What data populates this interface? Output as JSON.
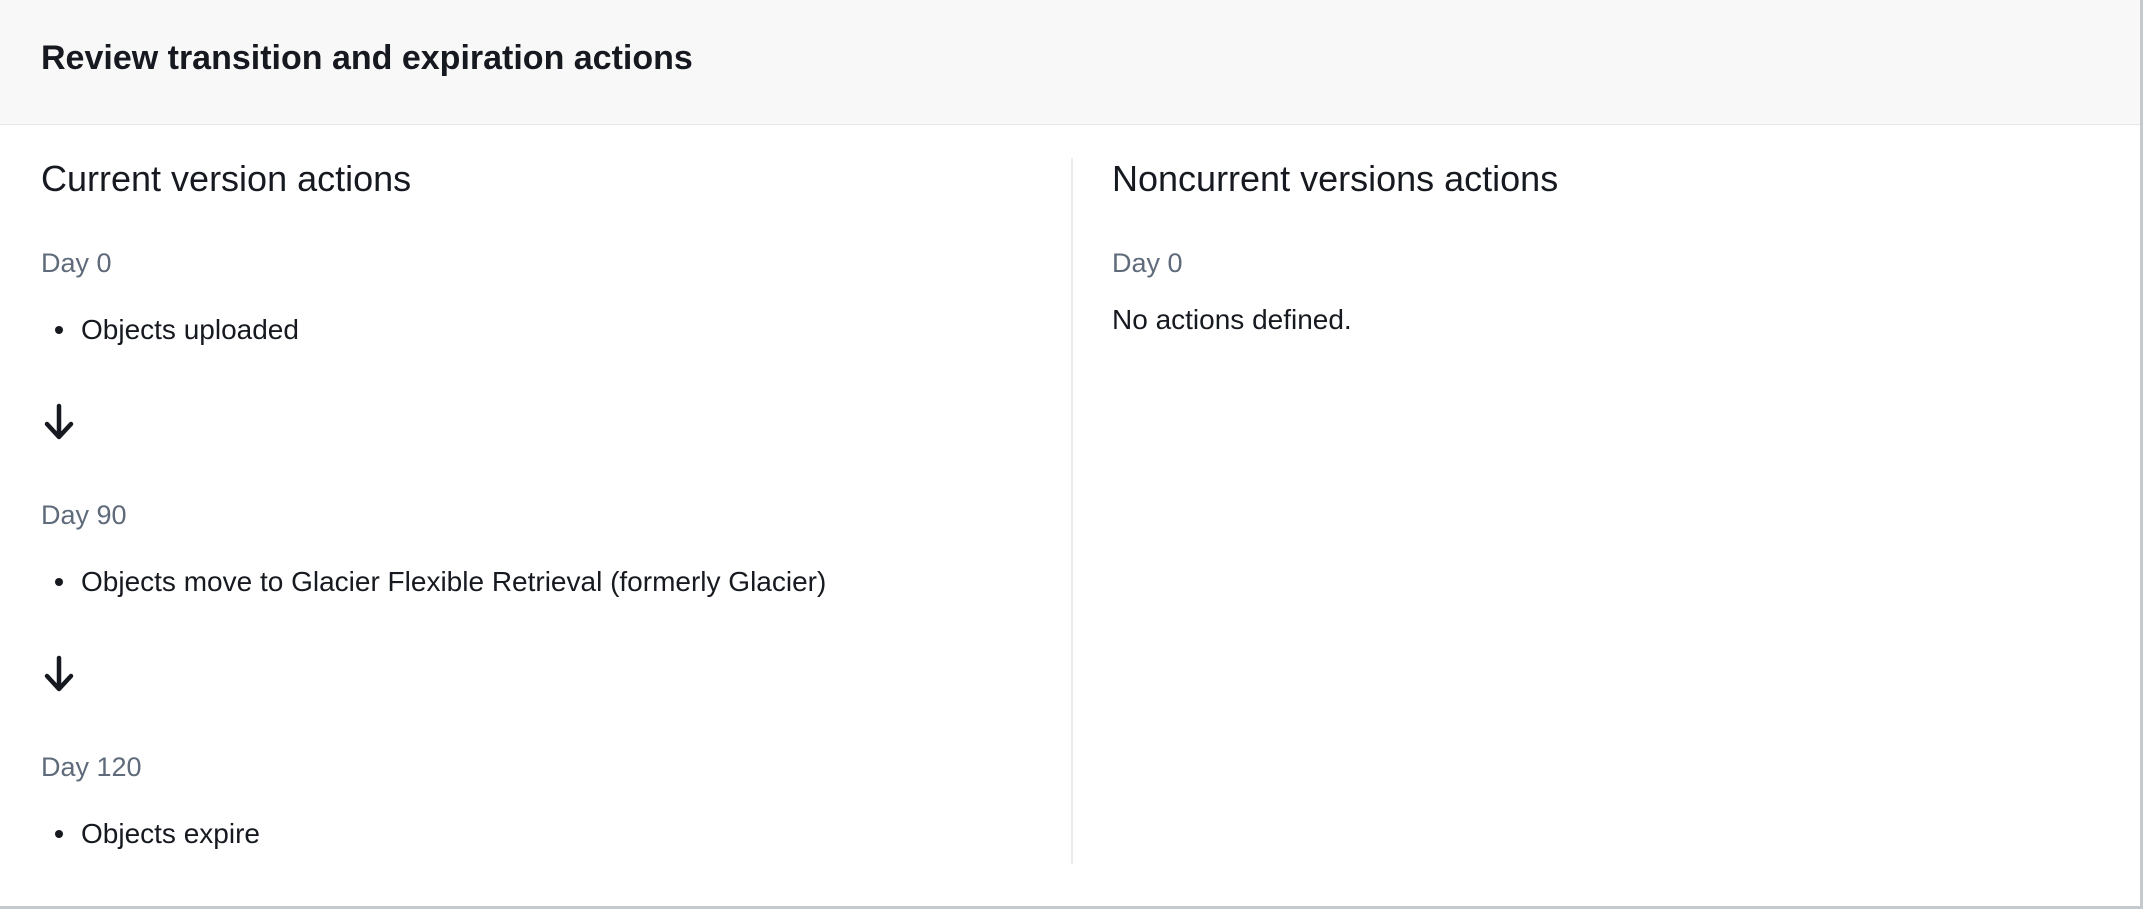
{
  "panel": {
    "title": "Review transition and expiration actions"
  },
  "current": {
    "title": "Current version actions",
    "steps": [
      {
        "day": "Day 0",
        "action": "Objects uploaded"
      },
      {
        "day": "Day 90",
        "action": "Objects move to Glacier Flexible Retrieval (formerly Glacier)"
      },
      {
        "day": "Day 120",
        "action": "Objects expire"
      }
    ],
    "arrow_icon": "arrow-down-icon"
  },
  "noncurrent": {
    "title": "Noncurrent versions actions",
    "day": "Day 0",
    "message": "No actions defined."
  },
  "colors": {
    "header_bg": "#f8f8f8",
    "text": "#16191f",
    "muted_text": "#5f6b7a",
    "border": "#c4c9ce"
  }
}
